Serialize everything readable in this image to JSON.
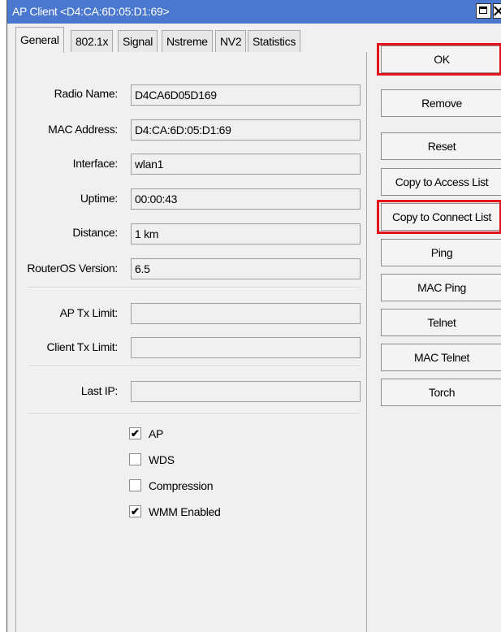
{
  "window": {
    "title": "AP Client <D4:CA:6D:05:D1:69>"
  },
  "tabs": [
    {
      "label": "General",
      "active": true
    },
    {
      "label": "802.1x",
      "active": false
    },
    {
      "label": "Signal",
      "active": false
    },
    {
      "label": "Nstreme",
      "active": false
    },
    {
      "label": "NV2",
      "active": false
    },
    {
      "label": "Statistics",
      "active": false
    }
  ],
  "fields": {
    "radio_name": {
      "label": "Radio Name:",
      "value": "D4CA6D05D169"
    },
    "mac_address": {
      "label": "MAC Address:",
      "value": "D4:CA:6D:05:D1:69"
    },
    "interface": {
      "label": "Interface:",
      "value": "wlan1"
    },
    "uptime": {
      "label": "Uptime:",
      "value": "00:00:43"
    },
    "distance": {
      "label": "Distance:",
      "value": "1 km"
    },
    "routeros_version": {
      "label": "RouterOS Version:",
      "value": "6.5"
    },
    "ap_tx_limit": {
      "label": "AP Tx Limit:",
      "value": ""
    },
    "client_tx_limit": {
      "label": "Client Tx Limit:",
      "value": ""
    },
    "last_ip": {
      "label": "Last IP:",
      "value": ""
    }
  },
  "checkboxes": {
    "ap": {
      "label": "AP",
      "checked": true
    },
    "wds": {
      "label": "WDS",
      "checked": false
    },
    "compression": {
      "label": "Compression",
      "checked": false
    },
    "wmm": {
      "label": "WMM Enabled",
      "checked": true
    }
  },
  "check_glyph": "✔",
  "buttons": {
    "ok": "OK",
    "remove": "Remove",
    "reset": "Reset",
    "copy_access": "Copy to Access List",
    "copy_connect": "Copy to Connect List",
    "ping": "Ping",
    "mac_ping": "MAC Ping",
    "telnet": "Telnet",
    "mac_telnet": "MAC Telnet",
    "torch": "Torch"
  },
  "colors": {
    "titlebar": "#4a78cf",
    "highlight": "#e2111b"
  }
}
